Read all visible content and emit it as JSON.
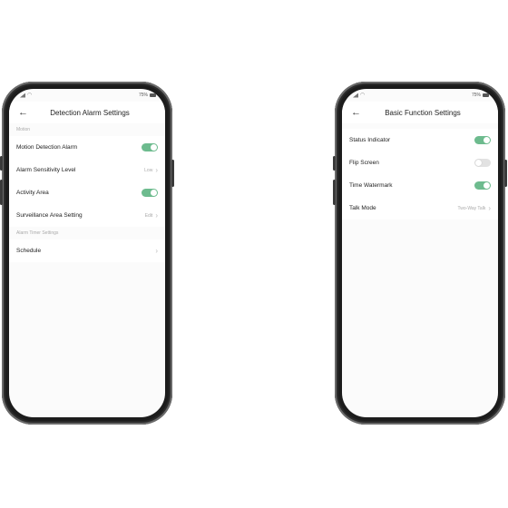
{
  "left_phone": {
    "status": {
      "battery": "75%"
    },
    "title": "Detection Alarm Settings",
    "section_motion": "Motion",
    "motion_detection_alarm": {
      "label": "Motion Detection Alarm",
      "on": true
    },
    "alarm_sensitivity_level": {
      "label": "Alarm Sensitivity Level",
      "value": "Low"
    },
    "activity_area": {
      "label": "Activity Area",
      "on": true
    },
    "surveillance_area_setting": {
      "label": "Surveillance Area Setting",
      "value": "Edit"
    },
    "section_timer": "Alarm Timer Settings",
    "schedule": {
      "label": "Schedule"
    }
  },
  "right_phone": {
    "status": {
      "battery": "75%"
    },
    "title": "Basic Function Settings",
    "status_indicator": {
      "label": "Status Indicator",
      "on": true
    },
    "flip_screen": {
      "label": "Flip Screen",
      "on": false
    },
    "time_watermark": {
      "label": "Time Watermark",
      "on": true
    },
    "talk_mode": {
      "label": "Talk Mode",
      "value": "Two-Way Talk"
    }
  },
  "icons": {
    "back": "arrow-left-icon",
    "chevron": "chevron-right-icon",
    "signal": "signal-icon",
    "wifi": "wifi-icon",
    "battery": "battery-icon"
  },
  "colors": {
    "toggle_on": "#6dbb8e",
    "toggle_off": "#e2e2e2",
    "frame": "#1c1c1c"
  }
}
